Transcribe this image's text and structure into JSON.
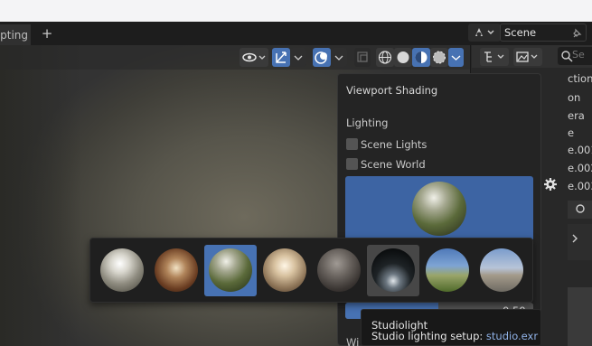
{
  "workspace_tab": {
    "label": "ipting",
    "add_label": "+"
  },
  "scene": {
    "label": "Scene"
  },
  "outliner": {
    "search_placeholder": "Se",
    "items": [
      "ction",
      "on",
      "era",
      "e",
      "e.001",
      "e.002",
      "e.003"
    ]
  },
  "shading_popover": {
    "title": "Viewport Shading",
    "lighting_label": "Lighting",
    "scene_lights_label": "Scene Lights",
    "scene_world_label": "Scene World",
    "strength_value_fragment": "0.50",
    "world_label_fragment": "Wi"
  },
  "hdri_thumbnails": [
    {
      "name": "city",
      "selected": false
    },
    {
      "name": "interior",
      "selected": false
    },
    {
      "name": "forest",
      "selected": true
    },
    {
      "name": "courtyard",
      "selected": false
    },
    {
      "name": "night",
      "selected": false
    },
    {
      "name": "studio",
      "selected": false,
      "hovered": true
    },
    {
      "name": "sunrise",
      "selected": false
    },
    {
      "name": "sunset",
      "selected": false
    }
  ],
  "tooltip": {
    "title": "Studiolight",
    "desc_label": "Studio lighting setup:",
    "desc_value": "studio.exr"
  },
  "colors": {
    "accent_blue": "#4772b3",
    "panel_bg": "#242424",
    "highlight_link": "#8fb1e6"
  }
}
